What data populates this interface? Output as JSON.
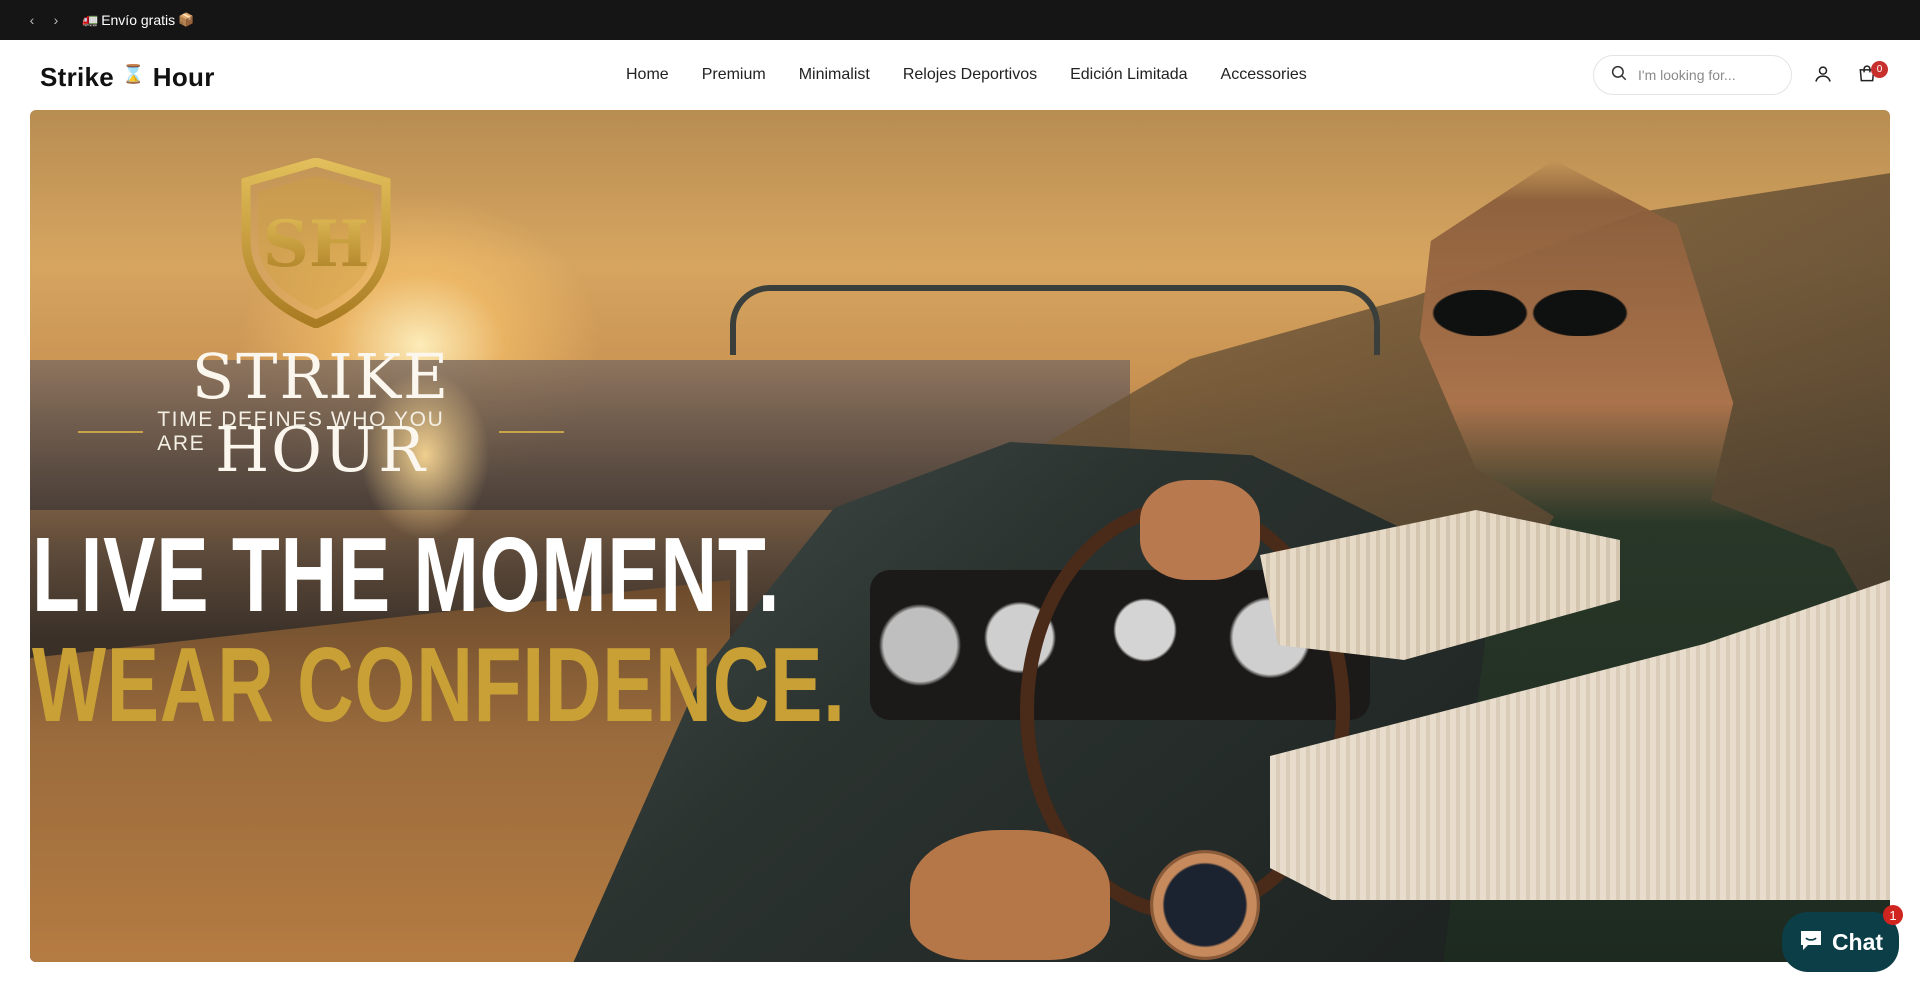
{
  "announcement": {
    "prev_arrow": "‹",
    "next_arrow": "›",
    "truck_emoji": "🚛",
    "text": "Envío gratis",
    "box_emoji": "📦"
  },
  "header": {
    "logo": {
      "left": "Strike",
      "icon": "⌛",
      "right": "Hour"
    },
    "nav": [
      "Home",
      "Premium",
      "Minimalist",
      "Relojes Deportivos",
      "Edición Limitada",
      "Accessories"
    ],
    "search": {
      "placeholder": "I'm looking for...",
      "icon": "search-icon"
    },
    "account_icon": "user-icon",
    "cart_icon": "cart-icon",
    "cart_count": "0"
  },
  "hero": {
    "shield_letters": "SH",
    "brand_name": "STRIKE HOUR",
    "tagline": "TIME DEFINES WHO YOU ARE",
    "headline_1": "LIVE THE MOMENT.",
    "headline_2": "WEAR CONFIDENCE.",
    "accent_color": "#c9a036"
  },
  "chat": {
    "label": "Chat",
    "badge": "1",
    "color": "#0c3e47"
  }
}
